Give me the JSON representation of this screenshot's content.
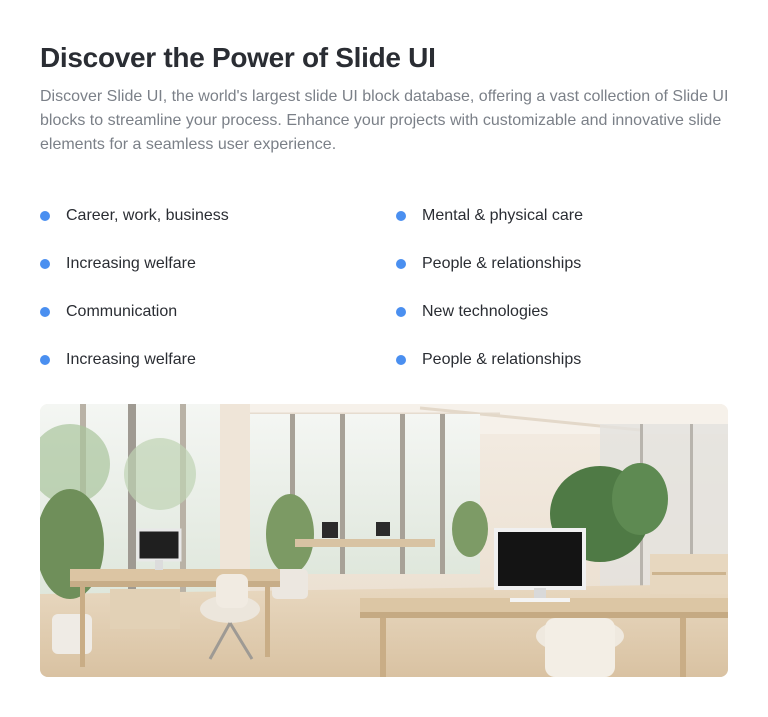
{
  "header": {
    "title": "Discover the Power of Slide UI",
    "intro": "Discover Slide UI, the world's largest slide UI block database, offering a vast collection of Slide UI blocks to streamline your process. Enhance your projects with customizable and innovative slide elements for a seamless user experience."
  },
  "features": {
    "bullet_color": "#4a8ff0",
    "items": [
      "Career, work, business",
      "Mental & physical care",
      "Increasing welfare",
      "People & relationships",
      "Communication",
      "New technologies",
      "Increasing welfare",
      "People & relationships"
    ]
  },
  "image": {
    "subject": "office-interior-illustration"
  }
}
